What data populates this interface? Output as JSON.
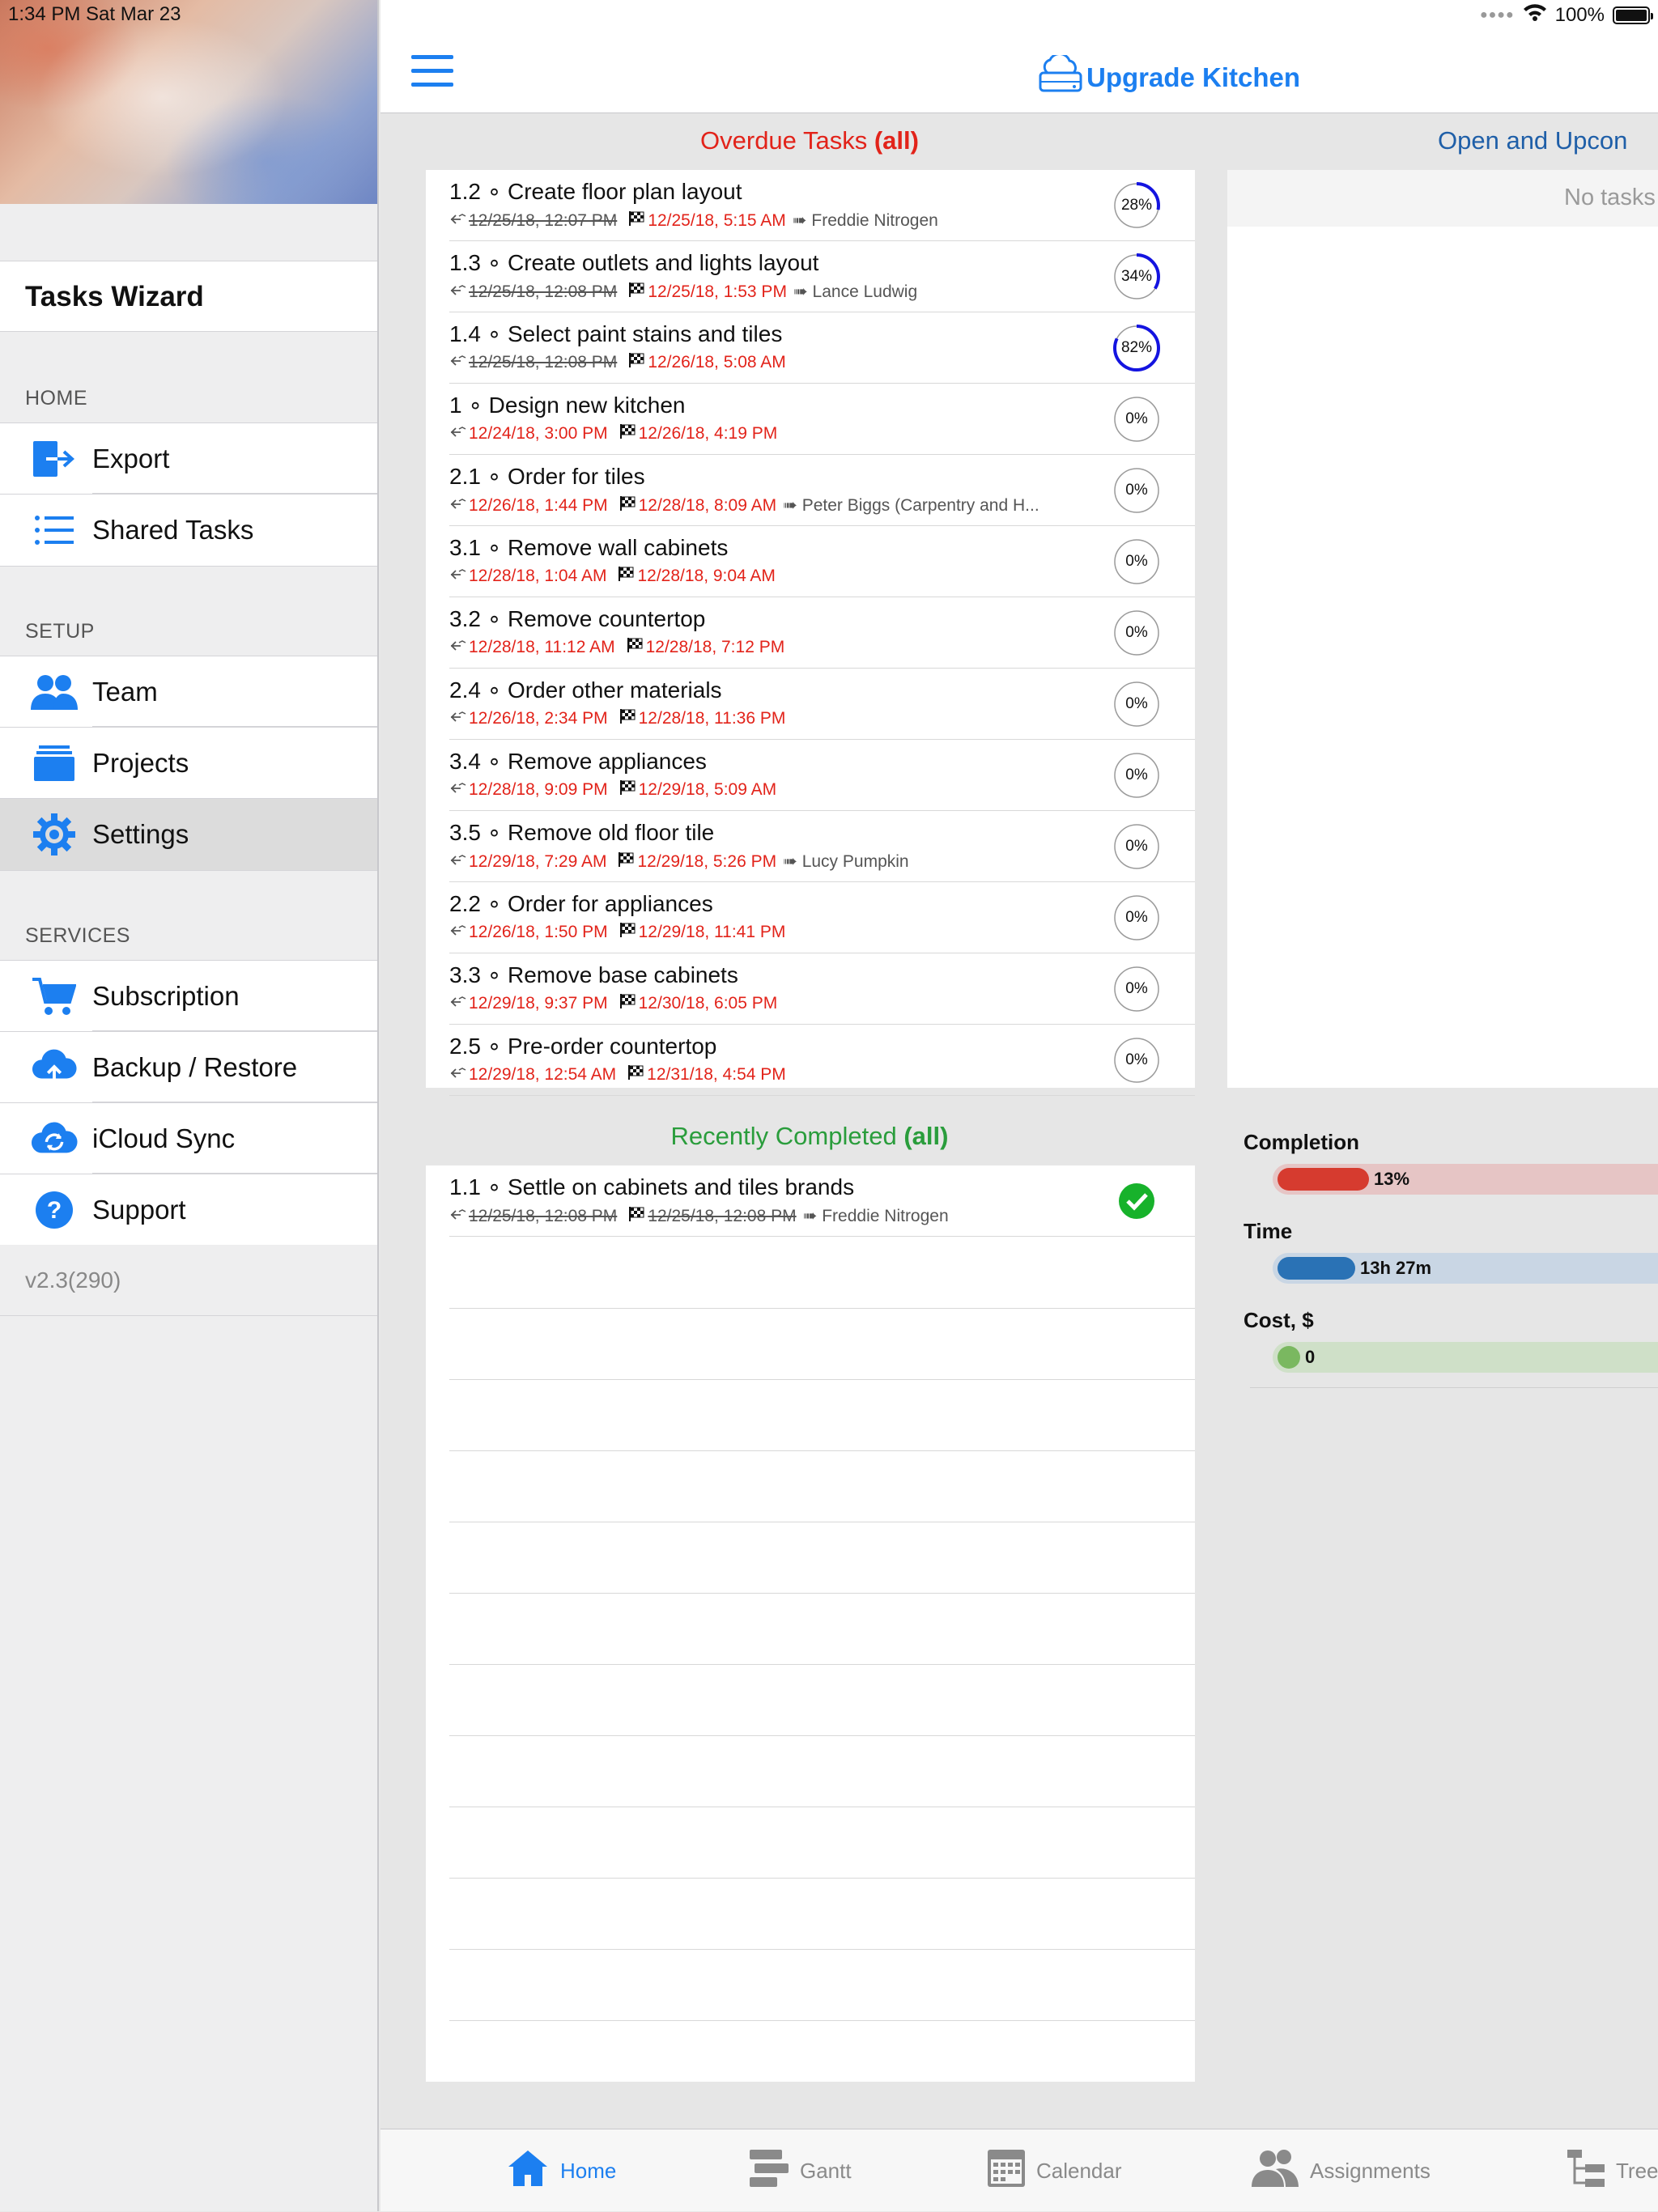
{
  "status_bar": {
    "time": "1:34 PM   Sat Mar 23",
    "battery": "100%"
  },
  "sidebar": {
    "title": "Tasks Wizard",
    "sections": [
      {
        "header": "HOME",
        "items": [
          {
            "label": "Export",
            "icon": "export-icon"
          },
          {
            "label": "Shared Tasks",
            "icon": "list-icon"
          }
        ]
      },
      {
        "header": "SETUP",
        "items": [
          {
            "label": "Team",
            "icon": "team-icon"
          },
          {
            "label": "Projects",
            "icon": "projects-icon"
          },
          {
            "label": "Settings",
            "icon": "gear-icon",
            "selected": true
          }
        ]
      },
      {
        "header": "SERVICES",
        "items": [
          {
            "label": "Subscription",
            "icon": "cart-icon"
          },
          {
            "label": "Backup / Restore",
            "icon": "cloud-upload-icon"
          },
          {
            "label": "iCloud Sync",
            "icon": "cloud-sync-icon"
          },
          {
            "label": "Support",
            "icon": "help-icon"
          }
        ]
      }
    ],
    "version": "v2.3(290)"
  },
  "header": {
    "title": "Upgrade Kitchen",
    "menu_icon": "hamburger-icon",
    "project_icon": "cloud-drive-icon"
  },
  "overdue": {
    "title": "Overdue Tasks",
    "filter": "(all)",
    "tasks": [
      {
        "title": "1.2 ∘ Create floor plan layout",
        "start": "12/25/18, 12:07 PM",
        "start_struck": true,
        "end": "12/25/18, 5:15 AM",
        "assignee": "Freddie Nitrogen",
        "progress": 28
      },
      {
        "title": "1.3 ∘ Create outlets and lights layout",
        "start": "12/25/18, 12:08 PM",
        "start_struck": true,
        "end": "12/25/18, 1:53 PM",
        "assignee": "Lance Ludwig",
        "progress": 34
      },
      {
        "title": "1.4 ∘ Select paint stains and tiles",
        "start": "12/25/18, 12:08 PM",
        "start_struck": true,
        "end": "12/26/18, 5:08 AM",
        "assignee": "",
        "progress": 82
      },
      {
        "title": "1 ∘ Design new kitchen",
        "start": "12/24/18, 3:00 PM",
        "start_struck": false,
        "end": "12/26/18, 4:19 PM",
        "assignee": "",
        "progress": 0
      },
      {
        "title": "2.1 ∘ Order for tiles",
        "start": "12/26/18, 1:44 PM",
        "start_struck": false,
        "end": "12/28/18, 8:09 AM",
        "assignee": "Peter Biggs (Carpentry and H...",
        "progress": 0
      },
      {
        "title": "3.1 ∘ Remove wall cabinets",
        "start": "12/28/18, 1:04 AM",
        "start_struck": false,
        "end": "12/28/18, 9:04 AM",
        "assignee": "",
        "progress": 0
      },
      {
        "title": "3.2 ∘ Remove countertop",
        "start": "12/28/18, 11:12 AM",
        "start_struck": false,
        "end": "12/28/18, 7:12 PM",
        "assignee": "",
        "progress": 0
      },
      {
        "title": "2.4 ∘ Order other materials",
        "start": "12/26/18, 2:34 PM",
        "start_struck": false,
        "end": "12/28/18, 11:36 PM",
        "assignee": "",
        "progress": 0
      },
      {
        "title": "3.4 ∘ Remove appliances",
        "start": "12/28/18, 9:09 PM",
        "start_struck": false,
        "end": "12/29/18, 5:09 AM",
        "assignee": "",
        "progress": 0
      },
      {
        "title": "3.5 ∘ Remove old floor tile",
        "start": "12/29/18, 7:29 AM",
        "start_struck": false,
        "end": "12/29/18, 5:26 PM",
        "assignee": "Lucy Pumpkin",
        "progress": 0
      },
      {
        "title": "2.2 ∘ Order for appliances",
        "start": "12/26/18, 1:50 PM",
        "start_struck": false,
        "end": "12/29/18, 11:41 PM",
        "assignee": "",
        "progress": 0
      },
      {
        "title": "3.3 ∘ Remove base cabinets",
        "start": "12/29/18, 9:37 PM",
        "start_struck": false,
        "end": "12/30/18, 6:05 PM",
        "assignee": "",
        "progress": 0
      },
      {
        "title": "2.5 ∘ Pre-order countertop",
        "start": "12/29/18, 12:54 AM",
        "start_struck": false,
        "end": "12/31/18, 4:54 PM",
        "assignee": "",
        "progress": 0
      }
    ]
  },
  "open_upcoming": {
    "title": "Open and Upcon",
    "empty_text": "No tasks"
  },
  "completed": {
    "title": "Recently Completed",
    "filter": "(all)",
    "tasks": [
      {
        "title": "1.1 ∘ Settle on cabinets and tiles brands",
        "start": "12/25/18, 12:08 PM",
        "end": "12/25/18, 12:08 PM",
        "assignee": "Freddie Nitrogen",
        "done": true
      }
    ]
  },
  "stats": {
    "completion": {
      "label": "Completion",
      "value": "13%",
      "fraction": 0.13,
      "color": "#d63b2f",
      "track": "#e6c5c5"
    },
    "time": {
      "label": "Time",
      "value": "13h 27m",
      "fraction": 0.11,
      "color": "#2a72b5",
      "track": "#c9d6e4"
    },
    "cost": {
      "label": "Cost, $",
      "value": "0",
      "fraction": 0.0,
      "color": "#7ab860",
      "track": "#cfe0c8"
    }
  },
  "tabs": [
    {
      "label": "Home",
      "icon": "home-icon",
      "active": true
    },
    {
      "label": "Gantt",
      "icon": "gantt-icon",
      "active": false
    },
    {
      "label": "Calendar",
      "icon": "calendar-icon",
      "active": false
    },
    {
      "label": "Assignments",
      "icon": "assignments-icon",
      "active": false
    },
    {
      "label": "Tree",
      "icon": "tree-icon",
      "active": false
    }
  ],
  "colors": {
    "accent": "#1c7ff0",
    "overdue": "#e2231a",
    "completed": "#2a9d3c",
    "open": "#1f5fa8",
    "ring": "#1414e0"
  }
}
